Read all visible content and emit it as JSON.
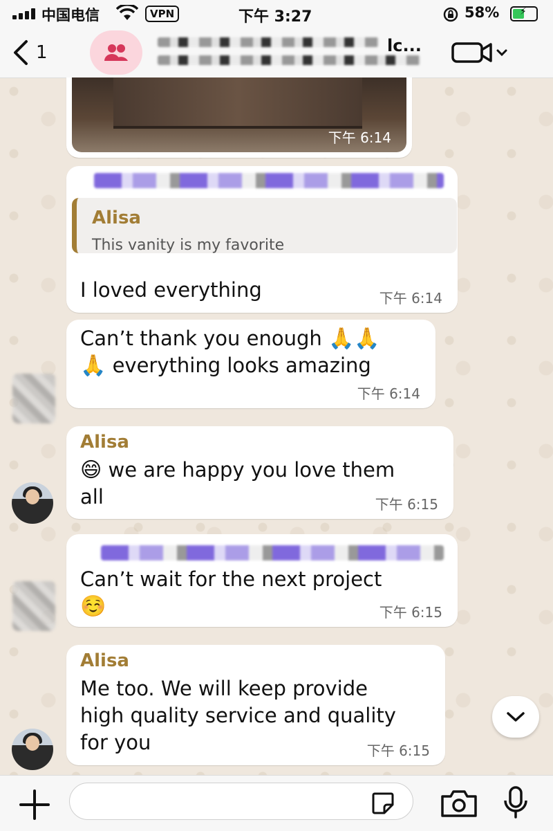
{
  "status_bar": {
    "carrier": "中国电信",
    "vpn": "VPN",
    "time": "下午 3:27",
    "battery_pct": "58%",
    "battery_level": 0.58
  },
  "header": {
    "back_count": "1",
    "title_visible_suffix": "lc..."
  },
  "messages": [
    {
      "type": "photo",
      "time": "下午 6:14"
    },
    {
      "type": "reply",
      "quote_sender": "Alisa",
      "quote_text": "This vanity is my favorite",
      "text": "I loved everything",
      "time": "下午 6:14"
    },
    {
      "type": "text",
      "line1": "Can’t thank you enough",
      "emoji1": "🙏🙏",
      "emoji2": "🙏",
      "line2": "everything looks amazing",
      "time": "下午 6:14"
    },
    {
      "type": "text",
      "sender": "Alisa",
      "emoji": "😄",
      "line1": "we are happy you love them",
      "line2": "all",
      "time": "下午 6:15"
    },
    {
      "type": "text",
      "line1": "Can’t wait for the next project",
      "emoji": "☺️",
      "time": "下午 6:15"
    },
    {
      "type": "text",
      "sender": "Alisa",
      "line1": "Me too. We will keep provide",
      "line2": "high quality service and quality",
      "line3": "for you",
      "time": "下午 6:15"
    }
  ],
  "input": {
    "placeholder": ""
  },
  "icons": {
    "back": "chevron-left-icon",
    "group": "group-icon",
    "video": "video-call-icon",
    "scroll": "chevron-down-icon",
    "plus": "plus-icon",
    "sticker": "sticker-icon",
    "camera": "camera-icon",
    "mic": "microphone-icon"
  }
}
